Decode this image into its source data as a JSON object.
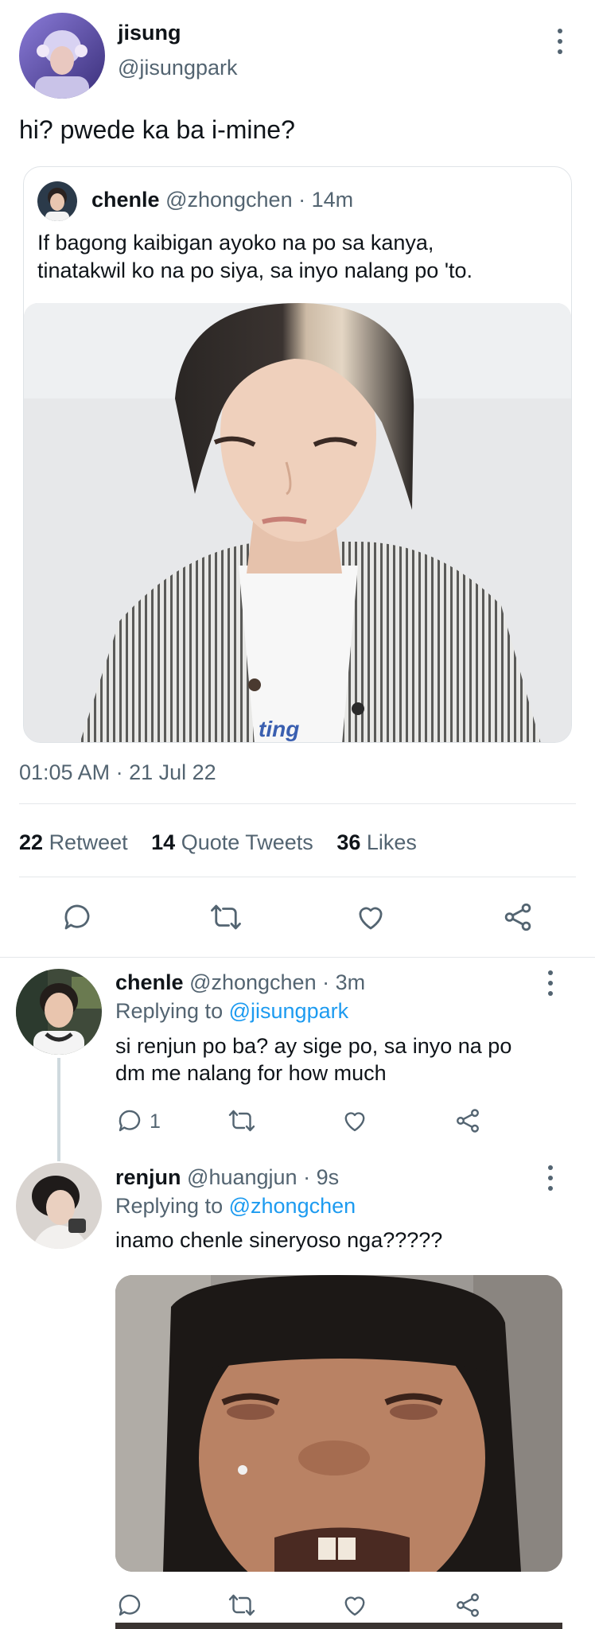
{
  "main_tweet": {
    "display_name": "jisung",
    "handle": "@jisungpark",
    "text": "hi? pwede ka ba i-mine?",
    "timestamp": "01:05 AM · 21 Jul 22"
  },
  "quoted_tweet": {
    "display_name": "chenle",
    "handle": "@zhongchen",
    "time": "· 14m",
    "text_line1": "If bagong kaibigan ayoko na po sa kanya,",
    "text_line2": "tinatakwil ko na po siya, sa inyo nalang po 'to."
  },
  "stats": {
    "retweets_count": "22",
    "retweets_label": "Retweet",
    "quotes_count": "14",
    "quotes_label": "Quote Tweets",
    "likes_count": "36",
    "likes_label": "Likes"
  },
  "replies": [
    {
      "display_name": "chenle",
      "handle": "@zhongchen",
      "time": "· 3m",
      "replying_prefix": "Replying to",
      "replying_to": "@jisungpark",
      "text_line1": "si renjun po ba? ay sige po, sa inyo na po",
      "text_line2": "dm me nalang for how much",
      "reply_count": "1"
    },
    {
      "display_name": "renjun",
      "handle": "@huangjun",
      "time": "· 9s",
      "replying_prefix": "Replying to",
      "replying_to": "@zhongchen",
      "text_line1": "inamo chenle sineryoso nga?????"
    }
  ],
  "icons": {
    "reply": "reply-icon",
    "retweet": "retweet-icon",
    "like": "heart-icon",
    "share": "share-icon",
    "more": "more-vertical-icon"
  },
  "colors": {
    "text": "#0f1419",
    "secondary": "#536471",
    "accent": "#1d9bf0",
    "divider": "#e4e7ea"
  }
}
